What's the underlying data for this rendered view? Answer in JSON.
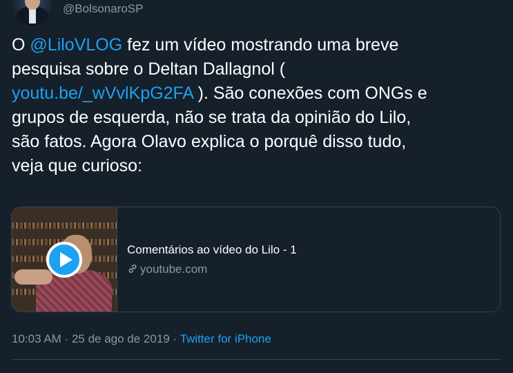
{
  "user": {
    "handle": "@BolsonaroSP"
  },
  "tweet": {
    "lines": [
      {
        "pre": "O ",
        "link": "@LiloVLOG",
        "post": " fez um vídeo mostrando uma breve"
      },
      {
        "text": "pesquisa sobre o Deltan Dallagnol ("
      },
      {
        "link": "youtu.be/_wVvlKpG2FA",
        "post": " ). São conexões com ONGs e"
      },
      {
        "text": "grupos de esquerda, não se trata da opinião do Lilo,"
      },
      {
        "text": "são fatos. Agora Olavo explica o porquê disso tudo,"
      },
      {
        "text": "veja que curioso:"
      }
    ]
  },
  "card": {
    "title": "Comentários ao vídeo do Lilo - 1",
    "domain": "youtube.com",
    "play_icon": "play-icon",
    "link_icon": "link-icon"
  },
  "meta": {
    "time": "10:03 AM",
    "separator1": " · ",
    "date": "25 de ago de 2019",
    "separator2": " · ",
    "source": "Twitter for iPhone"
  },
  "colors": {
    "background": "#15202b",
    "link": "#1da1f2",
    "secondary_text": "#8899a6",
    "border": "#38444d"
  }
}
